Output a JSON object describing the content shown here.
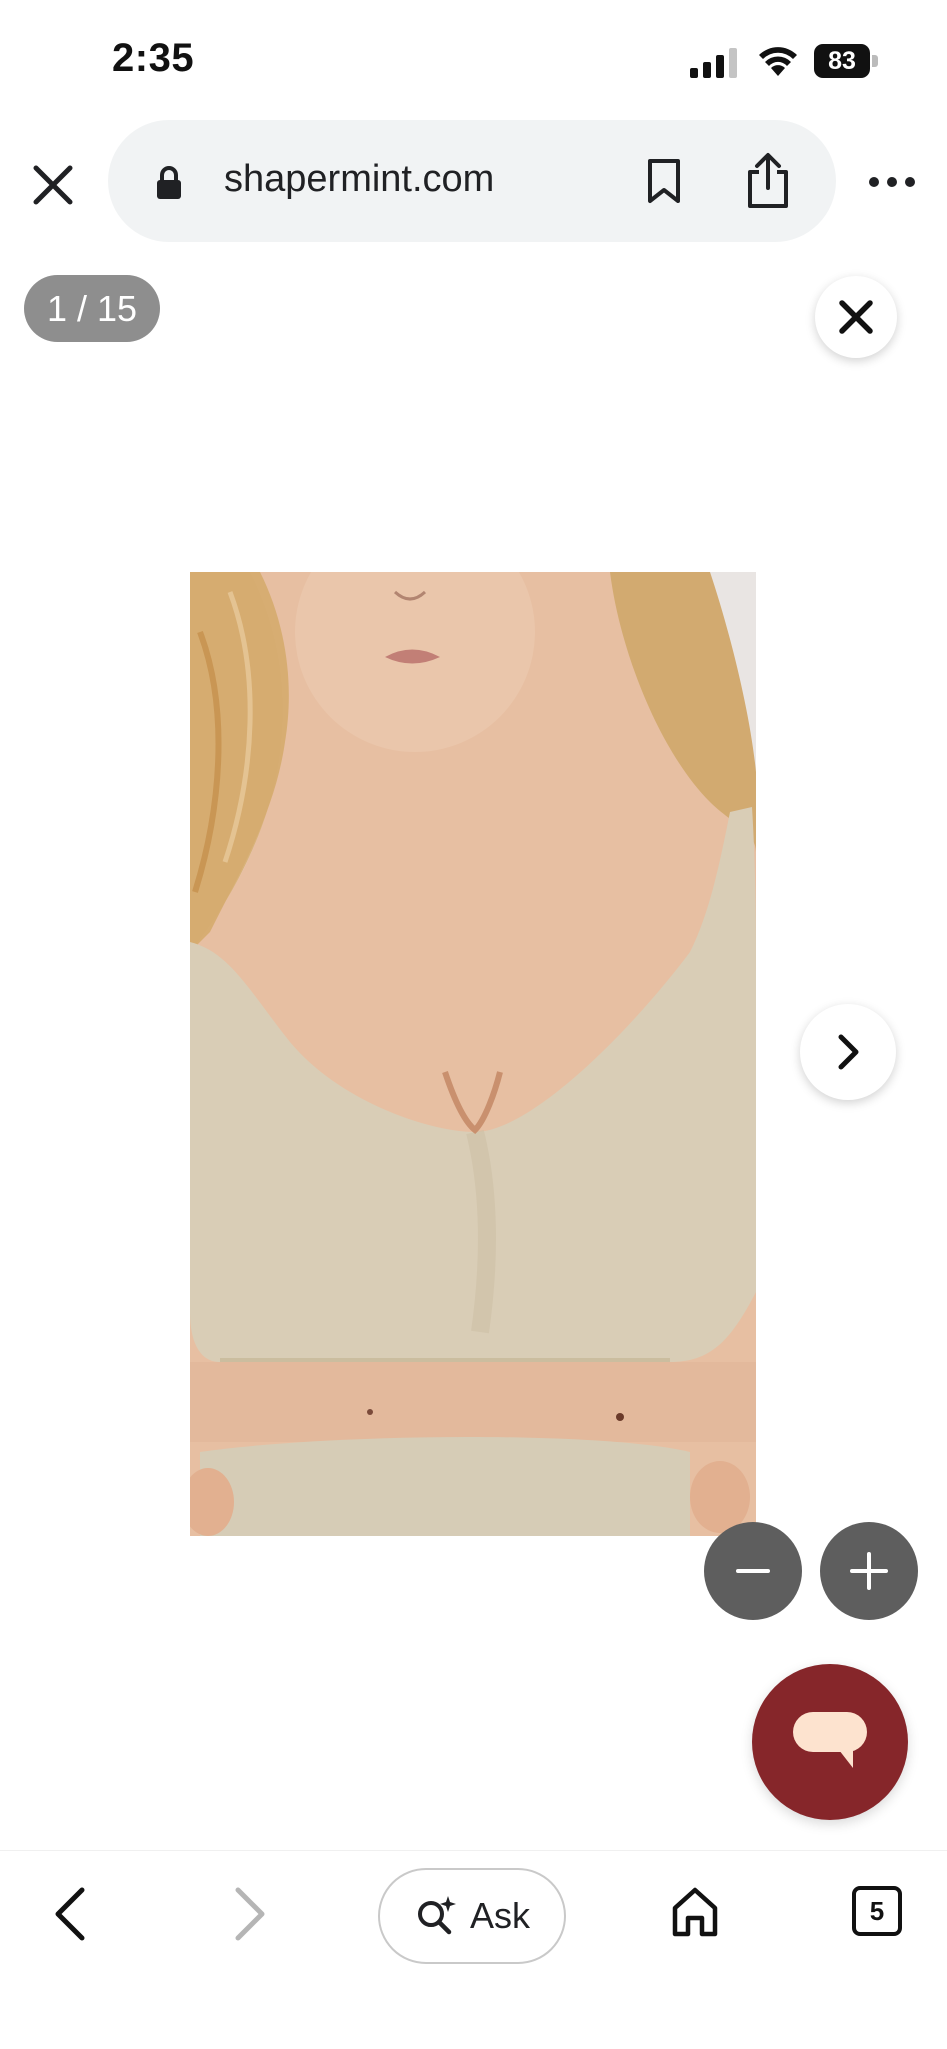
{
  "status_bar": {
    "time": "2:35",
    "battery": "83"
  },
  "browser": {
    "url": "shapermint.com",
    "icons": [
      "close-icon",
      "lock-icon",
      "bookmark-icon",
      "share-icon",
      "more-icon"
    ]
  },
  "gallery": {
    "counter": "1 / 15",
    "image_alt": "Woman wearing a nude seamless bralette",
    "icons": [
      "close-icon",
      "chevron-right-icon",
      "minus-icon",
      "plus-icon",
      "chat-icon"
    ]
  },
  "bottom_nav": {
    "ask_label": "Ask",
    "tab_count": "5",
    "icons": [
      "back-icon",
      "forward-icon",
      "sparkle-search-icon",
      "home-icon",
      "tabs-icon"
    ]
  },
  "colors": {
    "chat_button": "#86262A",
    "counter_pill": "#8E8E8E",
    "zoom_buttons": "#5E5E5E",
    "url_bar": "#F1F3F4"
  }
}
